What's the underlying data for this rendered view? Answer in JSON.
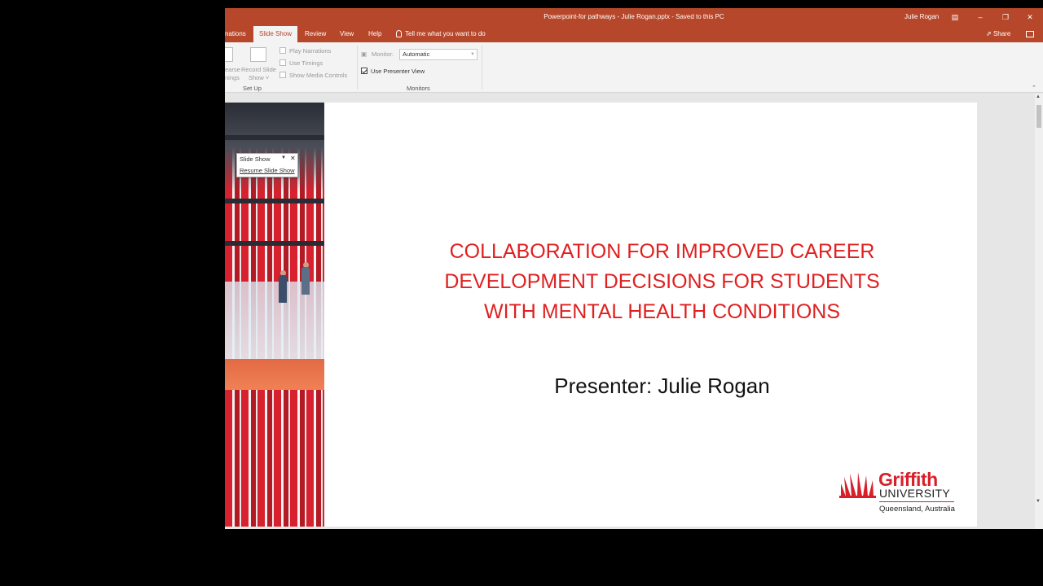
{
  "window": {
    "title": "Powerpoint-for pathways - Julie Rogan.pptx  -  Saved to this PC",
    "user": "Julie Rogan"
  },
  "ribbon_tabs": [
    "nations",
    "Slide Show",
    "Review",
    "View",
    "Help"
  ],
  "active_tab": "Slide Show",
  "tell_me": "Tell me what you want to do",
  "share_label": "Share",
  "setup_group": {
    "rehearse_label_1": "earse",
    "rehearse_label_2": "nings",
    "record_label_1": "Record Slide",
    "record_label_2": "Show ˅",
    "play_narrations": "Play Narrations",
    "use_timings": "Use Timings",
    "show_media_controls": "Show Media Controls",
    "group_label": "Set Up"
  },
  "monitors_group": {
    "monitor_label": "Monitor:",
    "monitor_value": "Automatic",
    "use_presenter_view": "Use Presenter View",
    "use_presenter_view_checked": true,
    "group_label": "Monitors"
  },
  "slideshow_panel": {
    "title": "Slide Show",
    "resume": "Resume Slide Show"
  },
  "slide": {
    "title_lines": [
      "COLLABORATION FOR IMPROVED CAREER",
      "DEVELOPMENT DECISIONS FOR STUDENTS",
      "WITH MENTAL HEALTH CONDITIONS"
    ],
    "subtitle": "Presenter: Julie Rogan",
    "logo": {
      "word1": "Griffith",
      "word2": "UNIVERSITY",
      "word3": "Queensland, Australia"
    }
  },
  "colors": {
    "ppt_accent": "#b7472a",
    "title_red": "#e02020",
    "griffith_red": "#d9202a"
  }
}
